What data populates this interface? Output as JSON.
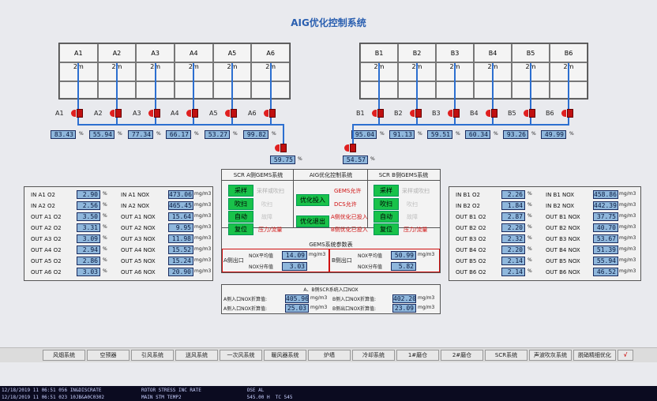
{
  "title": "AIG优化控制系统",
  "a_cols": [
    "A1",
    "A2",
    "A3",
    "A4",
    "A5",
    "A6"
  ],
  "b_cols": [
    "B1",
    "B2",
    "B3",
    "B4",
    "B5",
    "B6"
  ],
  "a_rows": [
    "2m",
    "2m",
    "2m",
    "2m",
    "2m",
    "2m"
  ],
  "b_rows": [
    "2m",
    "2m",
    "2m",
    "2m",
    "2m",
    "2m"
  ],
  "a_dampers": [
    "A1",
    "A2",
    "A3",
    "A4",
    "A5",
    "A6"
  ],
  "b_dampers": [
    "B1",
    "B2",
    "B3",
    "B4",
    "B5",
    "B6"
  ],
  "a_values": [
    "83.43",
    "55.94",
    "77.34",
    "66.17",
    "53.27",
    "99.82"
  ],
  "b_values": [
    "95.04",
    "91.13",
    "59.51",
    "60.34",
    "93.26",
    "49.99"
  ],
  "unit_pct": "%",
  "a_main": "59.75",
  "b_main": "54.57",
  "left_table": [
    {
      "l": "IN A1 O2",
      "v": "2.90",
      "u": "%",
      "l2": "IN A1 NOX",
      "v2": "473.06",
      "u2": "mg/m3"
    },
    {
      "l": "IN A2 O2",
      "v": "2.56",
      "u": "%",
      "l2": "IN A2 NOX",
      "v2": "465.45",
      "u2": "mg/m3"
    },
    {
      "l": "OUT A1 O2",
      "v": "3.50",
      "u": "%",
      "l2": "OUT A1 NOX",
      "v2": "15.64",
      "u2": "mg/m3"
    },
    {
      "l": "OUT A2 O2",
      "v": "3.31",
      "u": "%",
      "l2": "OUT A2 NOX",
      "v2": "9.95",
      "u2": "mg/m3"
    },
    {
      "l": "OUT A3 O2",
      "v": "3.09",
      "u": "%",
      "l2": "OUT A3 NOX",
      "v2": "11.98",
      "u2": "mg/m3"
    },
    {
      "l": "OUT A4 O2",
      "v": "2.94",
      "u": "%",
      "l2": "OUT A4 NOX",
      "v2": "15.52",
      "u2": "mg/m3"
    },
    {
      "l": "OUT A5 O2",
      "v": "2.86",
      "u": "%",
      "l2": "OUT A5 NOX",
      "v2": "15.24",
      "u2": "mg/m3"
    },
    {
      "l": "OUT A6 O2",
      "v": "3.03",
      "u": "%",
      "l2": "OUT A6 NOX",
      "v2": "20.90",
      "u2": "mg/m3"
    }
  ],
  "right_table": [
    {
      "l": "IN B1 O2",
      "v": "2.26",
      "u": "%",
      "l2": "IN B1 NOX",
      "v2": "458.86",
      "u2": "mg/m3"
    },
    {
      "l": "IN B2 O2",
      "v": "1.84",
      "u": "%",
      "l2": "IN B2 NOX",
      "v2": "442.39",
      "u2": "mg/m3"
    },
    {
      "l": "OUT B1 O2",
      "v": "2.87",
      "u": "%",
      "l2": "OUT B1 NOX",
      "v2": "37.75",
      "u2": "mg/m3"
    },
    {
      "l": "OUT B2 O2",
      "v": "2.20",
      "u": "%",
      "l2": "OUT B2 NOX",
      "v2": "40.70",
      "u2": "mg/m3"
    },
    {
      "l": "OUT B3 O2",
      "v": "2.32",
      "u": "%",
      "l2": "OUT B3 NOX",
      "v2": "53.67",
      "u2": "mg/m3"
    },
    {
      "l": "OUT B4 O2",
      "v": "2.20",
      "u": "%",
      "l2": "OUT B4 NOX",
      "v2": "51.39",
      "u2": "mg/m3"
    },
    {
      "l": "OUT B5 O2",
      "v": "2.14",
      "u": "%",
      "l2": "OUT B5 NOX",
      "v2": "55.94",
      "u2": "mg/m3"
    },
    {
      "l": "OUT B6 O2",
      "v": "2.14",
      "u": "%",
      "l2": "OUT B6 NOX",
      "v2": "46.52",
      "u2": "mg/m3"
    }
  ],
  "center": {
    "hdr_a": "SCR A侧GEMS系统",
    "hdr_mid": "AIG优化控制系统",
    "hdr_b": "SCR B侧GEMS系统",
    "a_buttons": [
      "采样",
      "吹扫",
      "自动",
      "复位"
    ],
    "a_status": [
      "采样或吹扫",
      "吹扫",
      "故障",
      "压力/流量"
    ],
    "mid_buttons": [
      "优化投入",
      "优化退出"
    ],
    "mid_status": [
      "GEMS允许",
      "DCS允许",
      "A侧优化已投入",
      "B侧优化已投入"
    ],
    "b_buttons": [
      "采样",
      "吹扫",
      "自动",
      "复位"
    ],
    "b_status": [
      "采样或吹扫",
      "吹扫",
      "故障",
      "压力/流量"
    ],
    "gems_title": "GEMS系统参数表",
    "a_outlet": "A侧出口",
    "b_outlet": "B侧出口",
    "nox_avg": "NOX平均值",
    "nox_dist": "NOX分布值",
    "a_avg": "14.09",
    "a_dist": "3.03",
    "b_avg": "50.99",
    "b_dist": "5.82",
    "unit_mg": "mg/m3",
    "inlet_title": "A、B侧SCR系统入口NOX",
    "a_in_lbl": "A侧入口NOX折算值:",
    "a_in_val": "405.96",
    "a_out_lbl": "A侧入口NOX折算值:",
    "a_out_val": "25.03",
    "b_in_lbl": "B侧入口NOX折算值:",
    "b_in_val": "402.20",
    "b_out_lbl": "B侧出口NOX折算值:",
    "b_out_val": "23.09"
  },
  "nav": [
    "风烟系统",
    "空预器",
    "引风系统",
    "送风系统",
    "一次风系统",
    "暖风器系统",
    "炉墙",
    "冷却系统",
    "1#磨仓",
    "2#磨仓",
    "SCR系统",
    "声波吹灰系统",
    "脱硝精细优化",
    "√"
  ],
  "status_lines": [
    "12/18/2019 11 06:51 056 IN&DISCRATE              ROTOR STRESS INC RATE                OSE AL",
    "12/18/2019 11 06:51 023 10JB&A0C0302             MAIN STM TEMP2                       545.00 H  TC 545"
  ]
}
